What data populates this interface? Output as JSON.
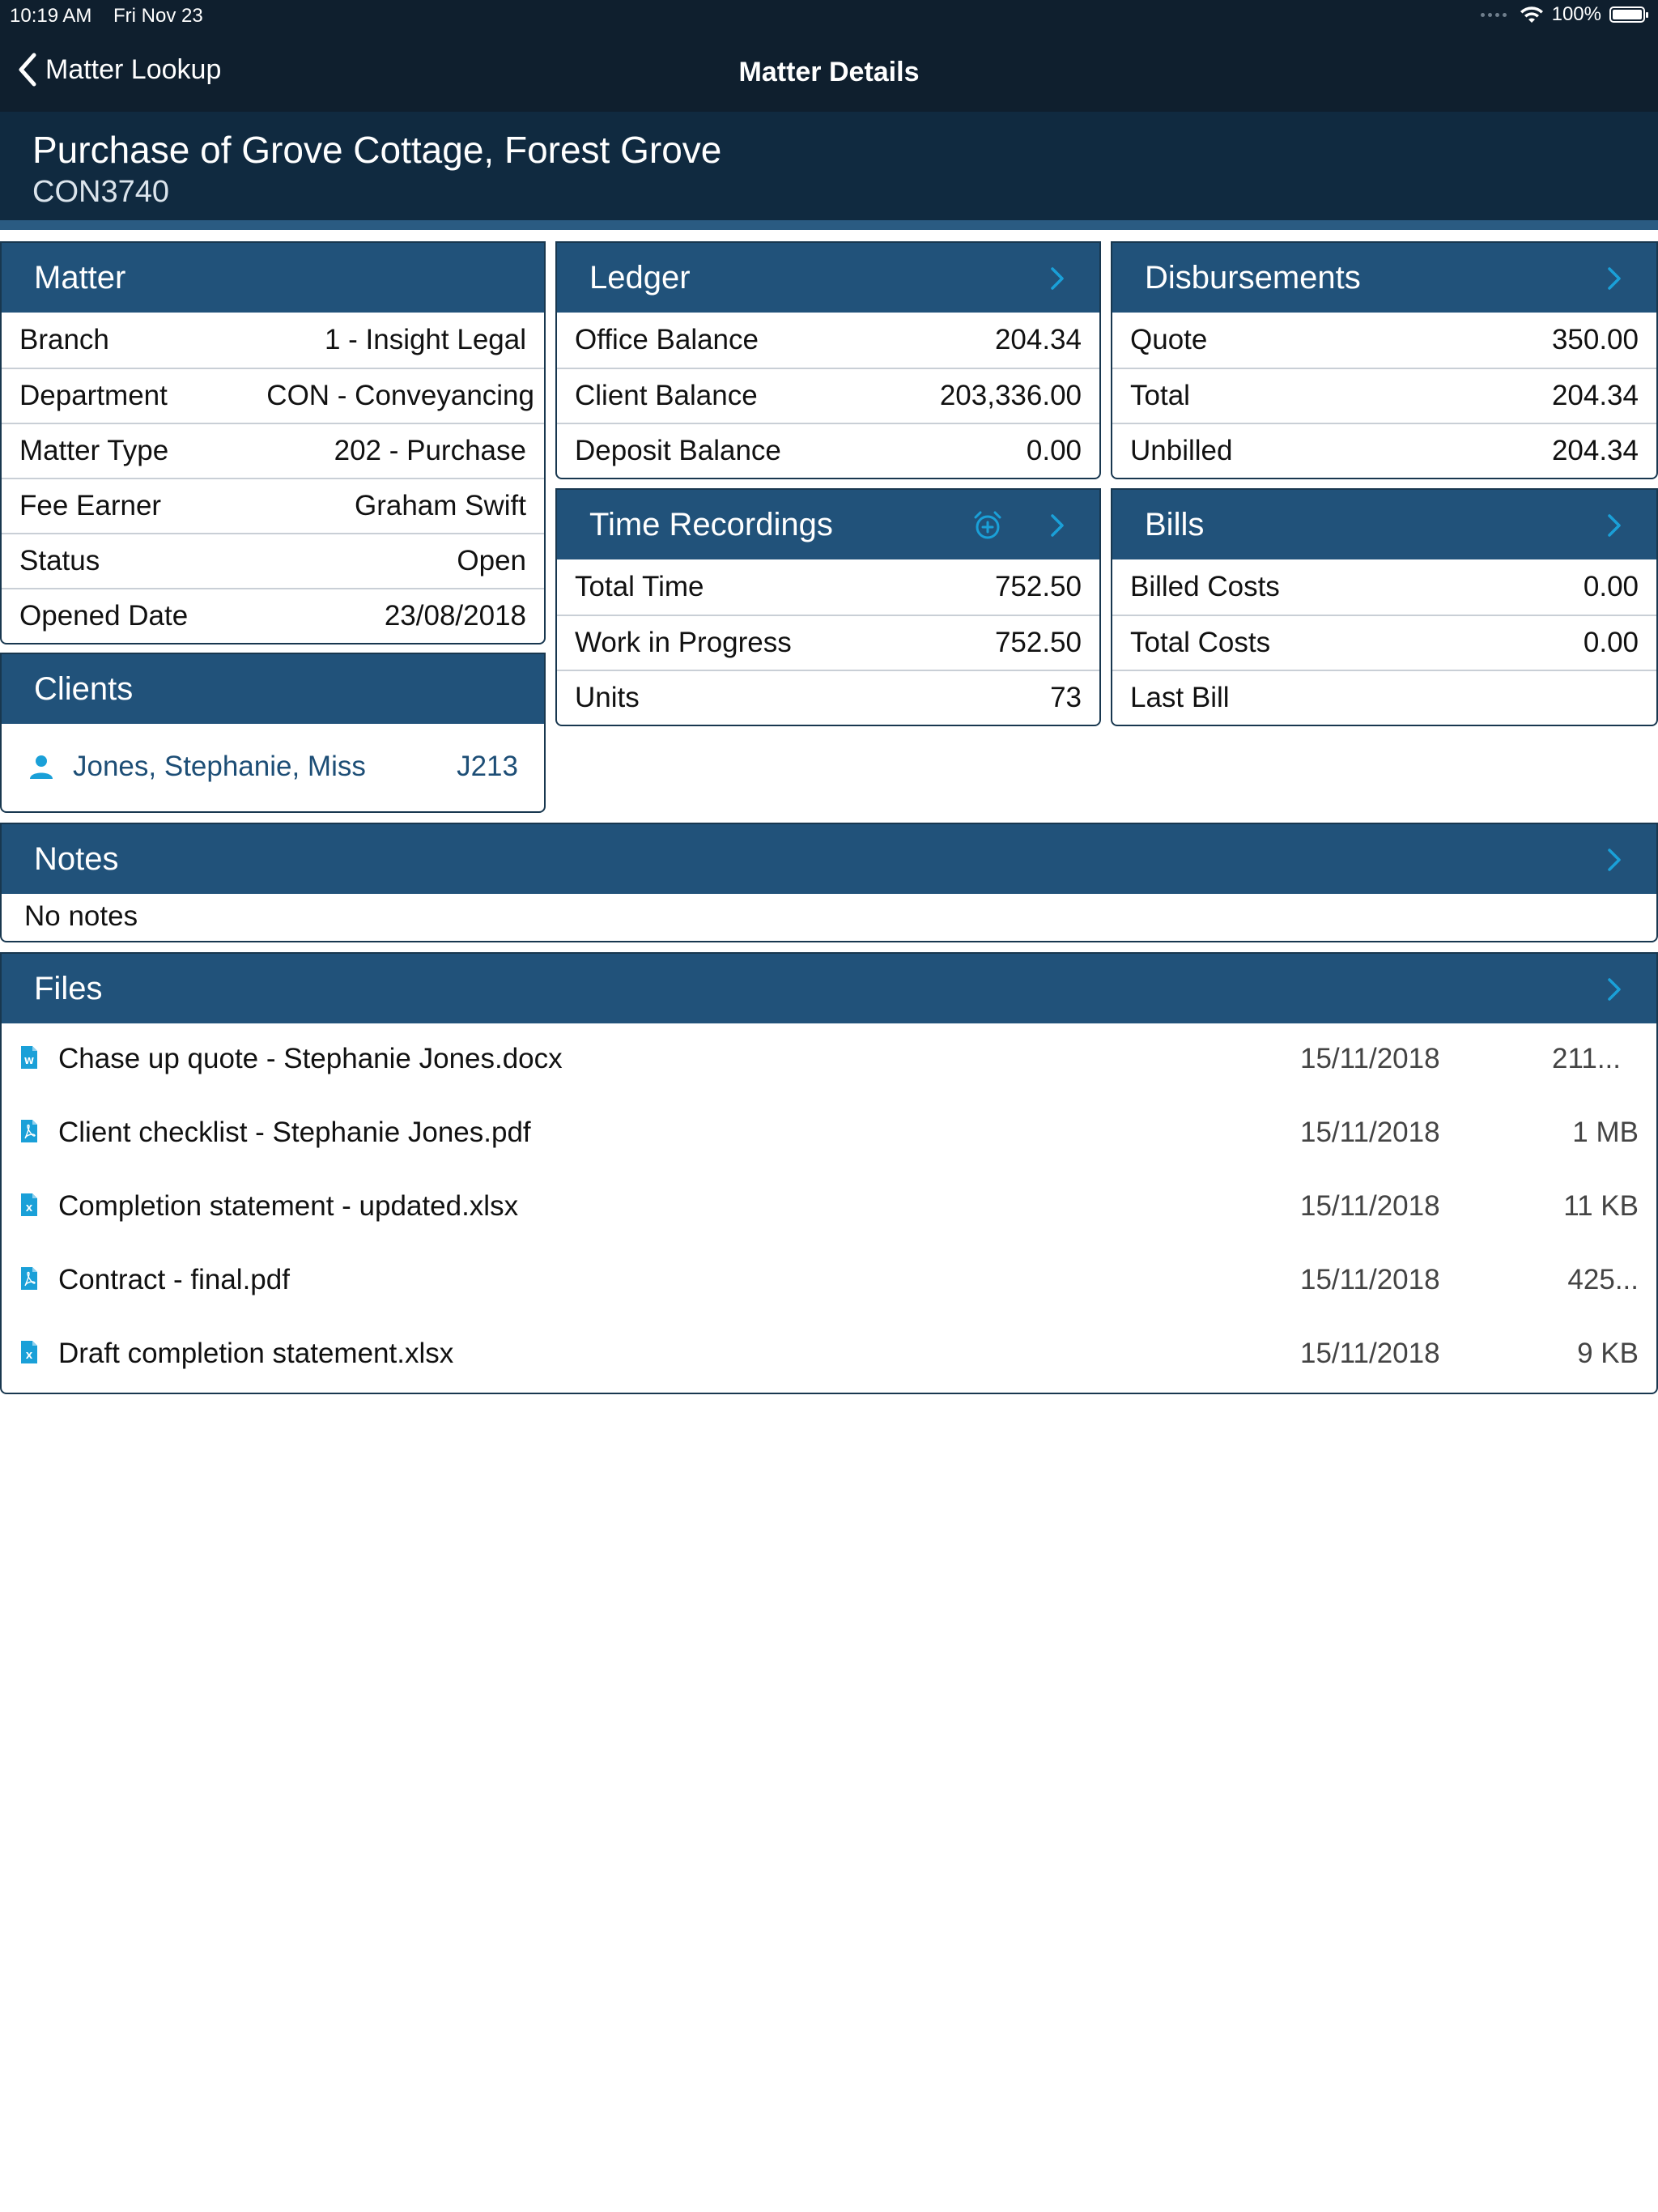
{
  "status_bar": {
    "time": "10:19 AM",
    "date": "Fri Nov 23",
    "battery": "100%"
  },
  "nav": {
    "back_label": "Matter Lookup",
    "title": "Matter Details"
  },
  "header": {
    "title": "Purchase of Grove Cottage, Forest Grove",
    "code": "CON3740"
  },
  "matter": {
    "title": "Matter",
    "rows": [
      {
        "label": "Branch",
        "value": "1 - Insight Legal"
      },
      {
        "label": "Department",
        "value": "CON - Conveyancing"
      },
      {
        "label": "Matter Type",
        "value": "202 - Purchase"
      },
      {
        "label": "Fee Earner",
        "value": "Graham Swift"
      },
      {
        "label": "Status",
        "value": "Open"
      },
      {
        "label": "Opened Date",
        "value": "23/08/2018"
      }
    ]
  },
  "ledger": {
    "title": "Ledger",
    "rows": [
      {
        "label": "Office Balance",
        "value": "204.34"
      },
      {
        "label": "Client Balance",
        "value": "203,336.00"
      },
      {
        "label": "Deposit Balance",
        "value": "0.00"
      }
    ]
  },
  "disbursements": {
    "title": "Disbursements",
    "rows": [
      {
        "label": "Quote",
        "value": "350.00"
      },
      {
        "label": "Total",
        "value": "204.34"
      },
      {
        "label": "Unbilled",
        "value": "204.34"
      }
    ]
  },
  "time_recordings": {
    "title": "Time Recordings",
    "rows": [
      {
        "label": "Total Time",
        "value": "752.50"
      },
      {
        "label": "Work in Progress",
        "value": "752.50"
      },
      {
        "label": "Units",
        "value": "73"
      }
    ]
  },
  "bills": {
    "title": "Bills",
    "rows": [
      {
        "label": "Billed Costs",
        "value": "0.00"
      },
      {
        "label": "Total Costs",
        "value": "0.00"
      },
      {
        "label": "Last Bill",
        "value": ""
      }
    ]
  },
  "clients": {
    "title": "Clients",
    "items": [
      {
        "name": "Jones, Stephanie, Miss",
        "id": "J213"
      }
    ]
  },
  "notes": {
    "title": "Notes",
    "text": "No notes"
  },
  "files": {
    "title": "Files",
    "items": [
      {
        "name": "Chase up quote - Stephanie Jones.docx",
        "date": "15/11/2018",
        "size": "211...",
        "icon": "word-file-icon"
      },
      {
        "name": "Client checklist - Stephanie Jones.pdf",
        "date": "15/11/2018",
        "size": "1 MB",
        "icon": "pdf-file-icon"
      },
      {
        "name": "Completion statement - updated.xlsx",
        "date": "15/11/2018",
        "size": "11 KB",
        "icon": "excel-file-icon"
      },
      {
        "name": "Contract - final.pdf",
        "date": "15/11/2018",
        "size": "425...",
        "icon": "pdf-file-icon"
      },
      {
        "name": "Draft completion statement.xlsx",
        "date": "15/11/2018",
        "size": "9 KB",
        "icon": "excel-file-icon"
      }
    ]
  },
  "colors": {
    "nav_bg": "#0f1f2e",
    "header_bg": "#102a40",
    "panel_head": "#21527a",
    "accent": "#1aa0d8"
  }
}
